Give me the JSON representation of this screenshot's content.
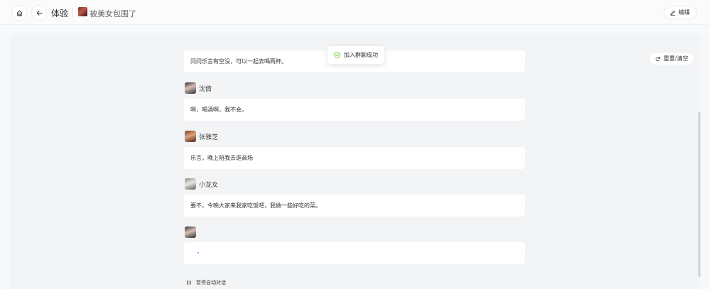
{
  "header": {
    "home_icon": "home-icon",
    "back_icon": "arrow-left-icon",
    "title": "体验",
    "chat_name": "被美女包围了",
    "edit_label": "编辑"
  },
  "toolbar": {
    "reset_label": "重置/清空"
  },
  "toast": {
    "message": "加入群聊成功",
    "icon": "check-circle-icon",
    "color": "#52c41a"
  },
  "messages": [
    {
      "speaker": "",
      "text": "问问乐言有空没，可以一起去喝两杯。"
    },
    {
      "speaker": "沈倩",
      "text": "啊，喝酒啊，我不会。"
    },
    {
      "speaker": "张雅芝",
      "text": "乐言，晚上陪我去逛商场"
    },
    {
      "speaker": "小龙女",
      "text": "要不，今晚大家来我家吃饭吧，我做一些好吃的菜。"
    },
    {
      "speaker": "",
      "text": ""
    }
  ],
  "footer": {
    "pause_label": "暂停自动对话"
  }
}
